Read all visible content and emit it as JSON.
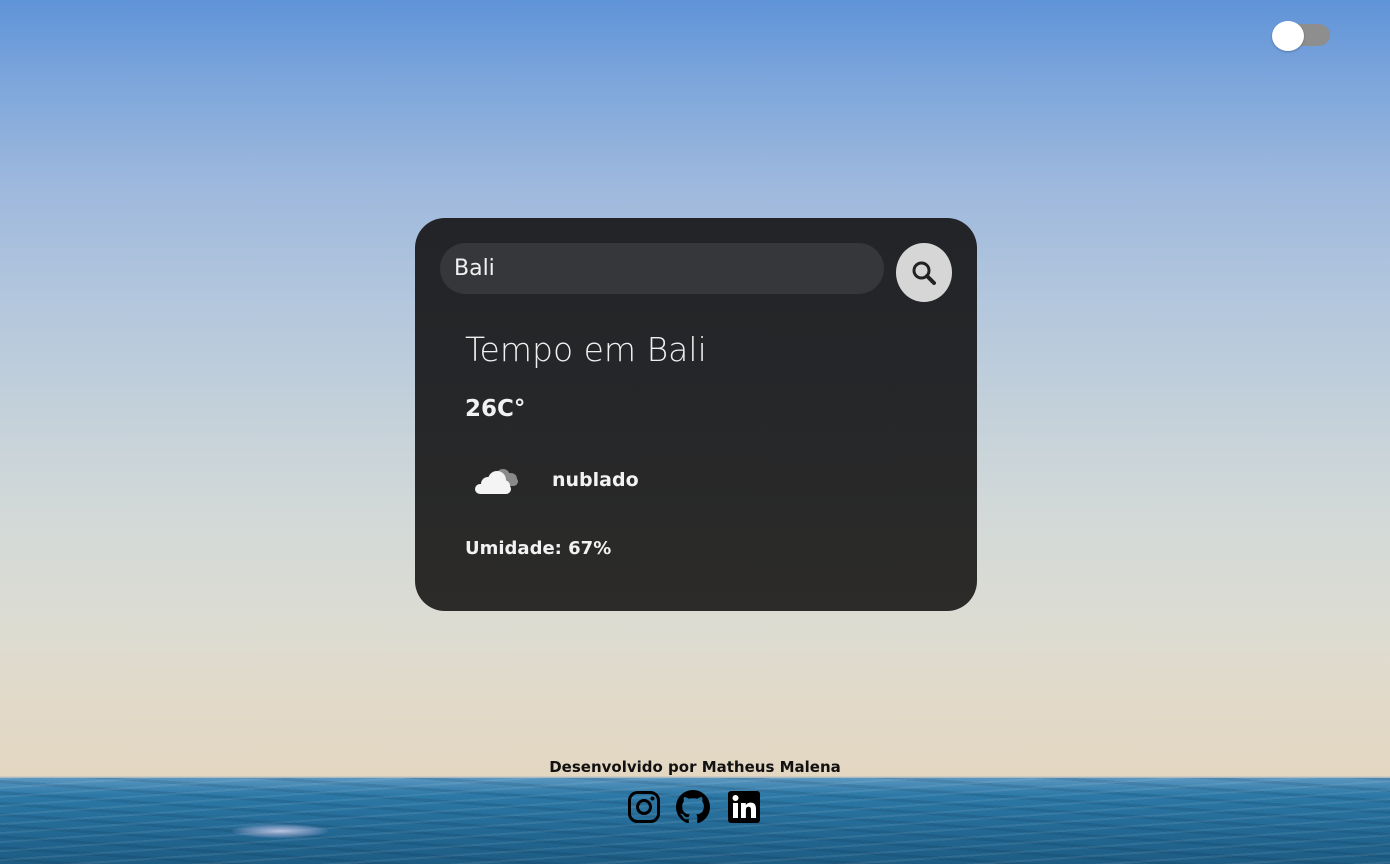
{
  "theme_toggle": {
    "state": "off"
  },
  "search": {
    "value": "Bali",
    "placeholder": ""
  },
  "weather": {
    "title": "Tempo em Bali",
    "temperature": "26C°",
    "condition_icon": "cloud-icon",
    "condition": "nublado",
    "humidity_label": "Umidade:",
    "humidity_value": "67%"
  },
  "footer": {
    "credit": "Desenvolvido por Matheus Malena",
    "social_icons": [
      "instagram-icon",
      "github-icon",
      "linkedin-icon"
    ]
  },
  "colors": {
    "card_background": "#262729",
    "search_background": "#35373b",
    "search_button": "#d6d6d6",
    "toggle_track": "#8e8e8e",
    "text": "#f2f2f2"
  }
}
